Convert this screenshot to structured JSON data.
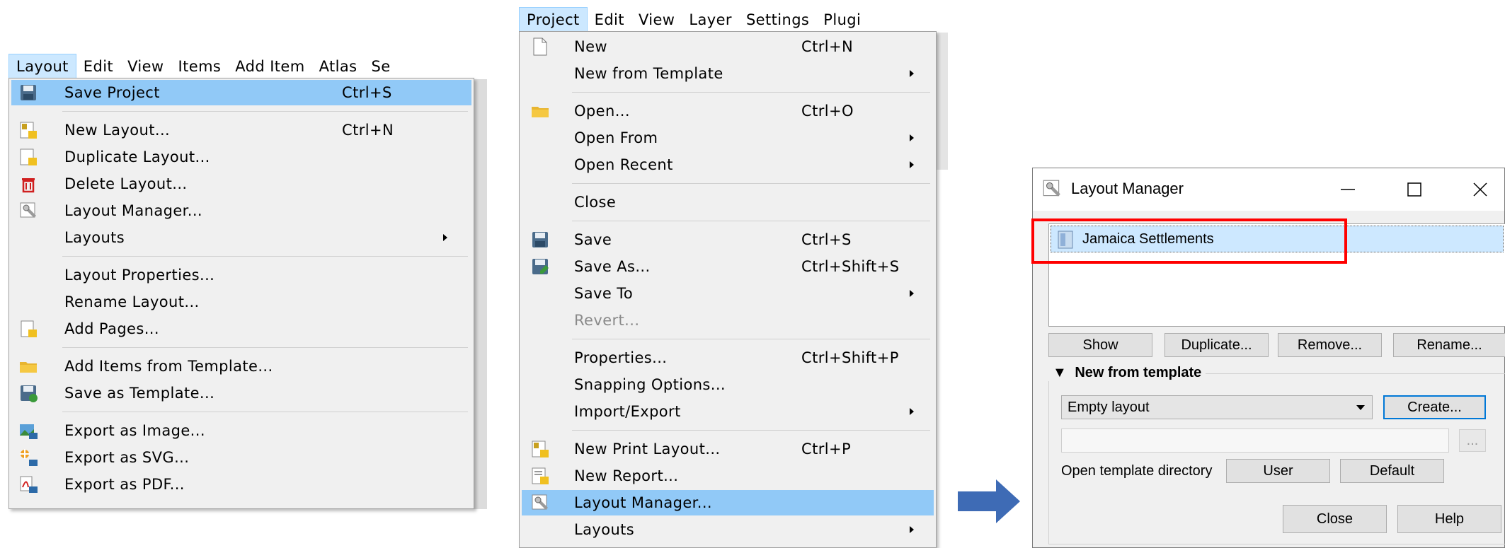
{
  "panel1": {
    "menubar": [
      "Layout",
      "Edit",
      "View",
      "Items",
      "Add Item",
      "Atlas",
      "Se"
    ],
    "items": [
      {
        "label": "Save Project",
        "shortcut": "Ctrl+S",
        "icon": "save-icon"
      },
      {
        "label": "New Layout...",
        "shortcut": "Ctrl+N",
        "icon": "new-layout-icon"
      },
      {
        "label": "Duplicate Layout...",
        "icon": "duplicate-layout-icon"
      },
      {
        "label": "Delete Layout...",
        "icon": "delete-layout-icon"
      },
      {
        "label": "Layout Manager...",
        "icon": "layout-manager-icon"
      },
      {
        "label": "Layouts"
      },
      {
        "label": "Layout Properties..."
      },
      {
        "label": "Rename Layout..."
      },
      {
        "label": "Add Pages...",
        "icon": "add-pages-icon"
      },
      {
        "label": "Add Items from Template...",
        "icon": "folder-icon"
      },
      {
        "label": "Save as Template...",
        "icon": "save-template-icon"
      },
      {
        "label": "Export as Image...",
        "icon": "export-image-icon"
      },
      {
        "label": "Export as SVG...",
        "icon": "export-svg-icon"
      },
      {
        "label": "Export as PDF...",
        "icon": "export-pdf-icon"
      }
    ]
  },
  "panel2": {
    "menubar": [
      "Project",
      "Edit",
      "View",
      "Layer",
      "Settings",
      "Plugi"
    ],
    "items": [
      {
        "label": "New",
        "shortcut": "Ctrl+N",
        "icon": "new-file-icon"
      },
      {
        "label": "New from Template"
      },
      {
        "label": "Open...",
        "shortcut": "Ctrl+O",
        "icon": "folder-icon"
      },
      {
        "label": "Open From"
      },
      {
        "label": "Open Recent"
      },
      {
        "label": "Close"
      },
      {
        "label": "Save",
        "shortcut": "Ctrl+S",
        "icon": "save-icon"
      },
      {
        "label": "Save As...",
        "shortcut": "Ctrl+Shift+S",
        "icon": "save-as-icon"
      },
      {
        "label": "Save To"
      },
      {
        "label": "Revert..."
      },
      {
        "label": "Properties...",
        "shortcut": "Ctrl+Shift+P"
      },
      {
        "label": "Snapping Options..."
      },
      {
        "label": "Import/Export"
      },
      {
        "label": "New Print Layout...",
        "shortcut": "Ctrl+P",
        "icon": "new-print-layout-icon"
      },
      {
        "label": "New Report...",
        "icon": "new-report-icon"
      },
      {
        "label": "Layout Manager...",
        "icon": "layout-manager-icon"
      },
      {
        "label": "Layouts"
      }
    ]
  },
  "dialog": {
    "title": "Layout Manager",
    "list_item": "Jamaica Settlements",
    "buttons": {
      "show": "Show",
      "duplicate": "Duplicate...",
      "remove": "Remove...",
      "rename": "Rename...",
      "create": "Create...",
      "browse": "...",
      "user": "User",
      "default": "Default",
      "close": "Close",
      "help": "Help"
    },
    "section": "New from template",
    "template_select": "Empty layout",
    "template_path": "",
    "open_dir_label": "Open template directory",
    "highlight_color": "#ff0000"
  },
  "colors": {
    "menu_highlight": "#91c9f7",
    "arrow": "#3e6bb5"
  }
}
